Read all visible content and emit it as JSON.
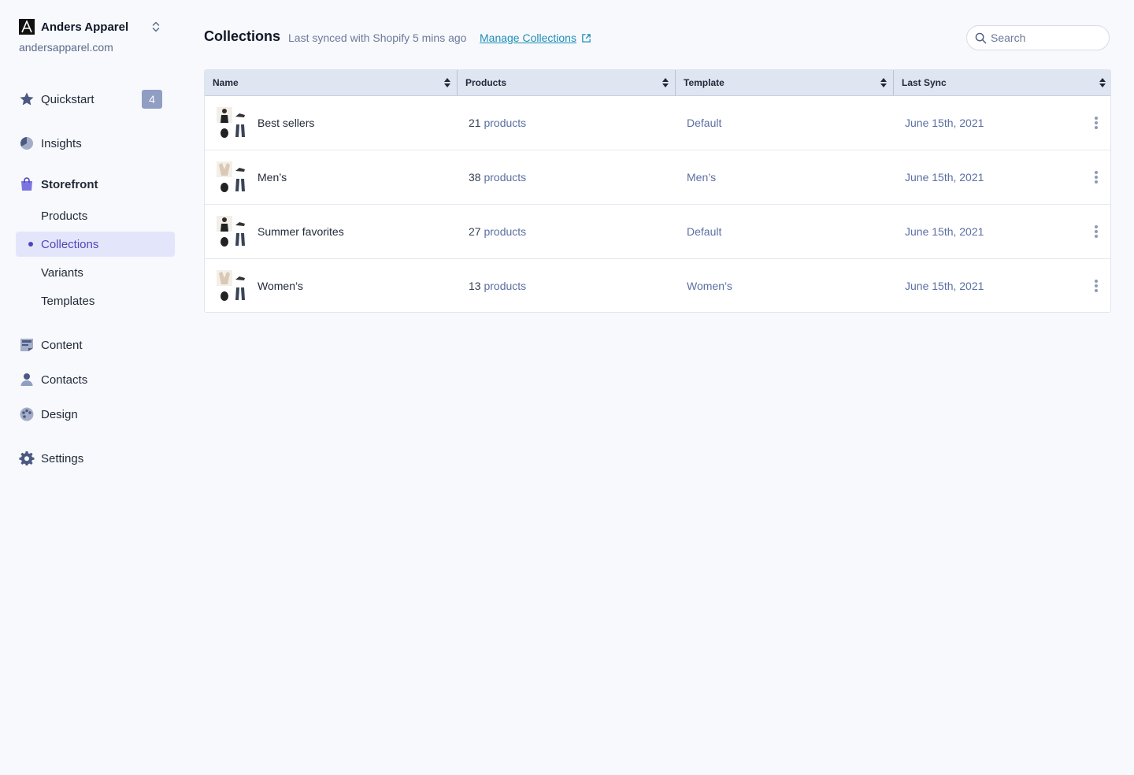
{
  "brand": {
    "name": "Anders Apparel",
    "url": "andersapparel.com"
  },
  "nav": {
    "quickstart": {
      "label": "Quickstart",
      "badge": "4"
    },
    "insights": {
      "label": "Insights"
    },
    "storefront": {
      "label": "Storefront"
    },
    "storefront_items": [
      {
        "label": "Products"
      },
      {
        "label": "Collections"
      },
      {
        "label": "Variants"
      },
      {
        "label": "Templates"
      }
    ],
    "content": {
      "label": "Content"
    },
    "contacts": {
      "label": "Contacts"
    },
    "design": {
      "label": "Design"
    },
    "settings": {
      "label": "Settings"
    }
  },
  "header": {
    "title": "Collections",
    "sync_text": "Last synced with Shopify 5 mins ago",
    "manage_link": "Manage Collections"
  },
  "search": {
    "placeholder": "Search"
  },
  "table": {
    "columns": [
      "Name",
      "Products",
      "Template",
      "Last Sync"
    ],
    "rows": [
      {
        "name": "Best sellers",
        "count": "21",
        "unit": "products",
        "template": "Default",
        "last_sync": "June 15th, 2021"
      },
      {
        "name": "Men’s",
        "count": "38",
        "unit": "products",
        "template": "Men’s",
        "last_sync": "June 15th, 2021"
      },
      {
        "name": "Summer favorites",
        "count": "27",
        "unit": "products",
        "template": "Default",
        "last_sync": "June 15th, 2021"
      },
      {
        "name": "Women’s",
        "count": "13",
        "unit": "products",
        "template": "Women’s",
        "last_sync": "June 15th, 2021"
      }
    ]
  },
  "colors": {
    "accent": "#4f46b5",
    "link": "#1d8fb8",
    "muted_text": "#5b6fa3",
    "badge_bg": "#8f9ec2",
    "header_bg": "#dfe5f1"
  }
}
